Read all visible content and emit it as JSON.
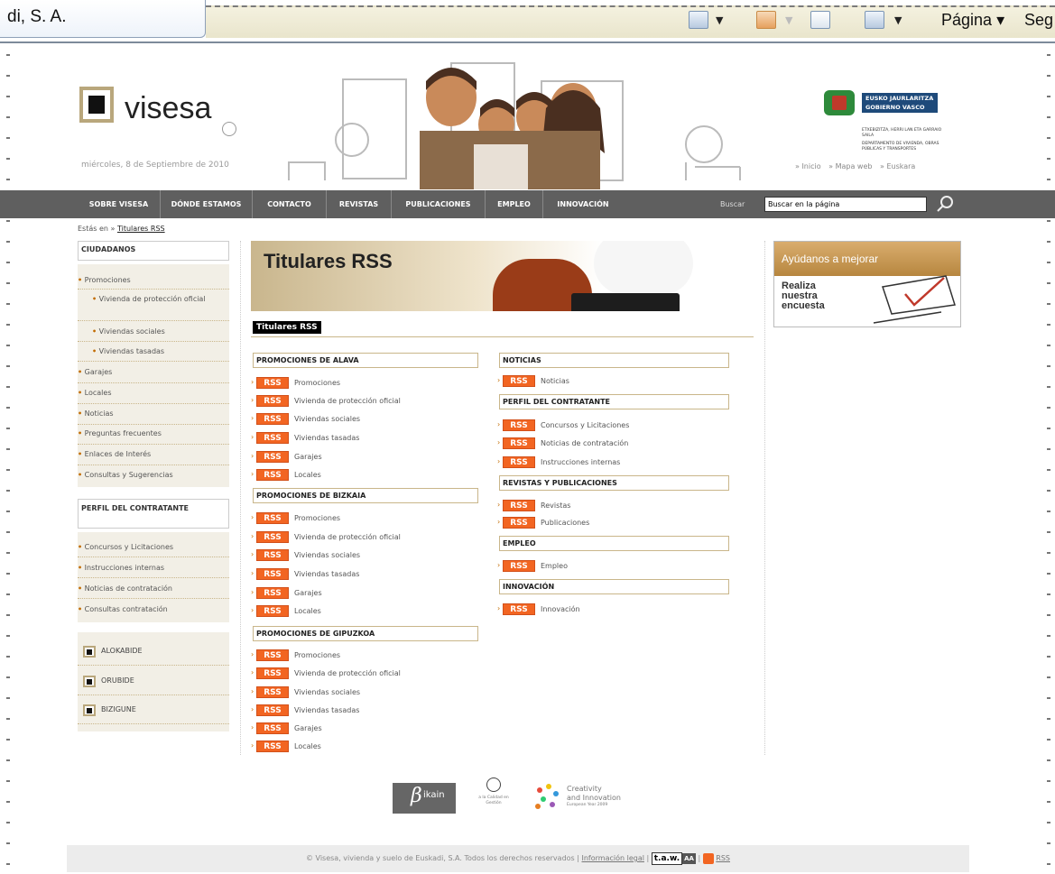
{
  "browser": {
    "tab_title": "di, S. A.",
    "page_menu": "Página",
    "seg_menu": "Seg"
  },
  "header": {
    "logo_text": "visesa",
    "date": "miércoles, 8 de Septiembre de 2010",
    "gov_line1": "EUSKO JAURLARITZA",
    "gov_line2": "GOBIERNO VASCO",
    "gov_small1": "ETXEBIZITZA, HERRI LAN ETA GARRAIO SAILA",
    "gov_small2": "DEPARTAMENTO DE VIVIENDA, OBRAS PÚBLICAS Y TRANSPORTES",
    "links": [
      "» Inicio",
      "» Mapa web",
      "» Euskara"
    ]
  },
  "nav": {
    "items": [
      "SOBRE VISESA",
      "DÓNDE ESTAMOS",
      "CONTACTO",
      "REVISTAS",
      "PUBLICACIONES",
      "EMPLEO",
      "INNOVACIÓN"
    ],
    "search_label": "Buscar",
    "search_value": "Buscar en la página"
  },
  "breadcrumb": {
    "prefix": "Estás en »",
    "current": "Titulares RSS"
  },
  "sidebar": {
    "ciudadanos_title": "CIUDADANOS",
    "ciudadanos_items": [
      "Promociones",
      "Vivienda de protección oficial",
      "Viviendas sociales",
      "Viviendas tasadas",
      "Garajes",
      "Locales",
      "Noticias",
      "Preguntas frecuentes",
      "Enlaces de Interés",
      "Consultas y Sugerencias"
    ],
    "perfil_title": "PERFIL DEL CONTRATANTE",
    "perfil_items": [
      "Concursos y Licitaciones",
      "Instrucciones internas",
      "Noticias de contratación",
      "Consultas contratación"
    ],
    "external": [
      "ALOKABIDE",
      "ORUBIDE",
      "BIZIGUNE"
    ]
  },
  "main": {
    "banner_title": "Titulares RSS",
    "section_title": "Titulares RSS",
    "rss_label": "RSS",
    "groups_left": [
      {
        "title": "PROMOCIONES DE ALAVA",
        "items": [
          "Promociones",
          "Vivienda de protección oficial",
          "Viviendas sociales",
          "Viviendas tasadas",
          "Garajes",
          "Locales"
        ]
      },
      {
        "title": "PROMOCIONES DE BIZKAIA",
        "items": [
          "Promociones",
          "Vivienda de protección oficial",
          "Viviendas sociales",
          "Viviendas tasadas",
          "Garajes",
          "Locales"
        ]
      },
      {
        "title": "PROMOCIONES DE GIPUZKOA",
        "items": [
          "Promociones",
          "Vivienda de protección oficial",
          "Viviendas sociales",
          "Viviendas tasadas",
          "Garajes",
          "Locales"
        ]
      }
    ],
    "groups_right": [
      {
        "title": "NOTICIAS",
        "items": [
          "Noticias"
        ]
      },
      {
        "title": "PERFIL DEL CONTRATANTE",
        "items": [
          "Concursos y Licitaciones",
          "Noticias de contratación",
          "Instrucciones internas"
        ]
      },
      {
        "title": "REVISTAS Y PUBLICACIONES",
        "items": [
          "Revistas",
          "Publicaciones"
        ]
      },
      {
        "title": "EMPLEO",
        "items": [
          "Empleo"
        ]
      },
      {
        "title": "INNOVACIÓN",
        "items": [
          "Innovación"
        ]
      }
    ]
  },
  "right": {
    "survey_title": "Ayúdanos a mejorar",
    "survey_text": [
      "Realiza",
      "nuestra",
      "encuesta"
    ]
  },
  "logos": {
    "bikain": "ikain",
    "bikain_beta": "β",
    "calidad": "a la Calidad en Gestión",
    "creativity1": "Creativity",
    "creativity2": "and Innovation",
    "creativity3": "European Year 2009"
  },
  "footer": {
    "copyright": "© Visesa, vivienda y suelo de Euskadi, S.A. Todos los derechos reservados |",
    "legal": "Información legal",
    "taw": "t.a.w.",
    "taw_aa": "AA",
    "rss": "RSS"
  },
  "colors": {
    "rss_orange": "#f26522",
    "nav_gray": "#5f5f5f",
    "accent_tan": "#c9b68a",
    "gov_blue": "#1e4a7a"
  }
}
